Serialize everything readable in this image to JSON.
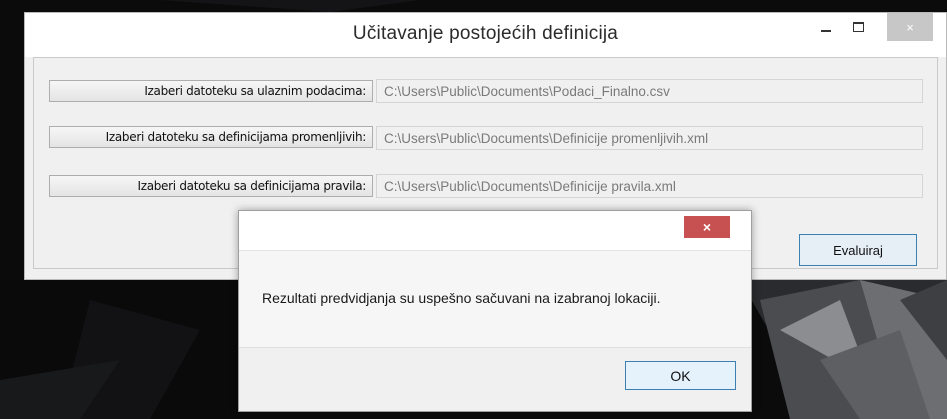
{
  "main_window": {
    "title": "Učitavanje postojećih definicija",
    "controls": {
      "minimize_icon": "minimize-icon",
      "maximize_icon": "maximize-icon",
      "close_symbol": "×"
    },
    "rows": [
      {
        "button_label": "Izaberi datoteku sa ulaznim podacima:",
        "path": "C:\\Users\\Public\\Documents\\Podaci_Finalno.csv"
      },
      {
        "button_label": "Izaberi datoteku sa definicijama promenljivih:",
        "path": "C:\\Users\\Public\\Documents\\Definicije promenljivih.xml"
      },
      {
        "button_label": "Izaberi datoteku sa definicijama pravila:",
        "path": "C:\\Users\\Public\\Documents\\Definicije pravila.xml"
      }
    ],
    "evaluate_label": "Evaluiraj"
  },
  "message_box": {
    "close_symbol": "×",
    "message": "Rezultati predvidjanja su uspešno sačuvani na izabranoj lokaciji.",
    "ok_label": "OK"
  },
  "colors": {
    "close_red": "#c75050",
    "focus_border": "#3c7fb1"
  }
}
